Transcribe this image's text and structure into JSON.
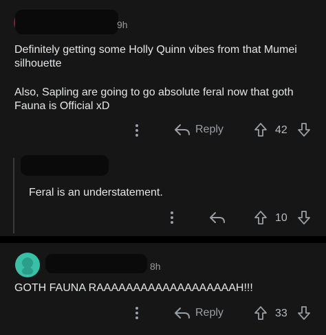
{
  "comments": [
    {
      "time": "9h",
      "body_lines": [
        "Definitely getting some Holly Quinn vibes from that Mumei",
        "silhouette",
        "Also, Sapling are going to go absolute feral now that goth",
        "Fauna is Official xD"
      ],
      "reply_label": "Reply",
      "vote_count": "42"
    },
    {
      "body_lines": [
        "Feral is an understatement."
      ],
      "vote_count": "10"
    },
    {
      "time": "8h",
      "body_lines": [
        "GOTH FAUNA RAAAAAAAAAAAAAAAAAAAH!!!"
      ],
      "reply_label": "Reply",
      "vote_count": "33"
    }
  ],
  "colors": {
    "card_bg": "#161616",
    "text": "#e4e6e8",
    "muted": "#9aa0a6",
    "avatar": "#38c1a7"
  },
  "icons": [
    "more-icon",
    "reply-icon",
    "upvote-icon",
    "downvote-icon"
  ]
}
